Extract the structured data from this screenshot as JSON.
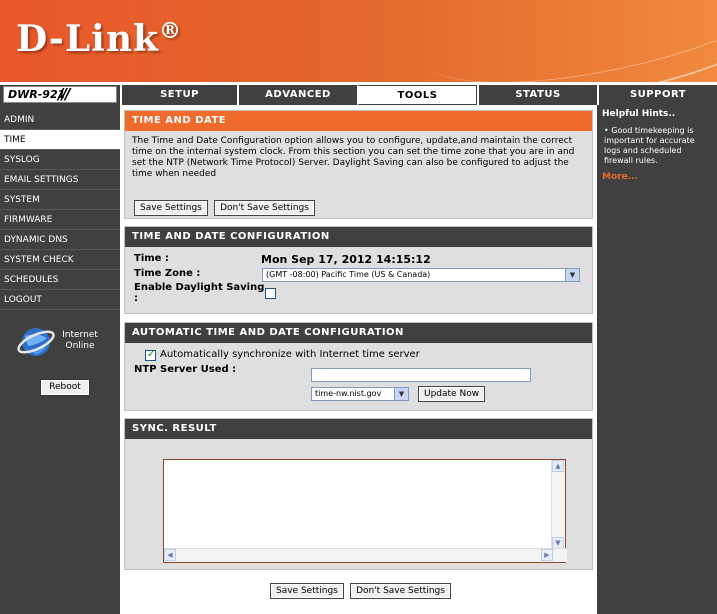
{
  "brand": {
    "logo_text": "D-Link",
    "logo_dot": "®",
    "model": "DWR-921",
    "slashes": "///"
  },
  "nav": {
    "tabs": [
      {
        "label": "SETUP",
        "active": false
      },
      {
        "label": "ADVANCED",
        "active": false
      },
      {
        "label": "TOOLS",
        "active": true
      },
      {
        "label": "STATUS",
        "active": false
      },
      {
        "label": "SUPPORT",
        "active": false
      }
    ]
  },
  "sidebar": {
    "items": [
      "ADMIN",
      "TIME",
      "SYSLOG",
      "EMAIL SETTINGS",
      "SYSTEM",
      "FIRMWARE",
      "DYNAMIC DNS",
      "SYSTEM CHECK",
      "SCHEDULES",
      "LOGOUT"
    ],
    "active_item": "TIME",
    "internet_status_line1": "Internet",
    "internet_status_line2": "Online",
    "reboot_label": "Reboot"
  },
  "time_and_date": {
    "title": "TIME AND DATE",
    "description": "The Time and Date Configuration option allows you to configure, update,and maintain the correct time on the internal system clock. From this section you can set the time zone that you are in and set the NTP (Network Time Protocol) Server. Daylight Saving can also be configured to adjust the time when needed",
    "save_label": "Save Settings",
    "dont_save_label": "Don't Save Settings"
  },
  "config": {
    "title": "TIME AND DATE CONFIGURATION",
    "time_label": "Time :",
    "time_value": "Mon Sep 17, 2012 14:15:12",
    "timezone_label": "Time Zone :",
    "timezone_value": "(GMT -08:00) Pacific Time (US & Canada)",
    "daylight_label_line1": "Enable Daylight Saving",
    "daylight_label_line2": ":",
    "daylight_checked": false
  },
  "auto_config": {
    "title": "AUTOMATIC TIME AND DATE CONFIGURATION",
    "sync_label": "Automatically synchronize with Internet time server",
    "sync_checked": true,
    "ntp_label": "NTP Server Used :",
    "ntp_input_value": "",
    "ntp_server_value": "time-nw.nist.gov",
    "update_label": "Update Now"
  },
  "sync_result": {
    "title": "SYNC. RESULT",
    "content": ""
  },
  "footer": {
    "save_label": "Save Settings",
    "dont_save_label": "Don't Save Settings"
  },
  "hints": {
    "title": "Helpful Hints..",
    "bullet": "•",
    "body": "Good timekeeping is important for accurate logs and scheduled firewall rules.",
    "more": "More..."
  },
  "colors": {
    "accent": "#ef6b2b",
    "dark": "#404040",
    "panel": "#dfdfdf"
  }
}
